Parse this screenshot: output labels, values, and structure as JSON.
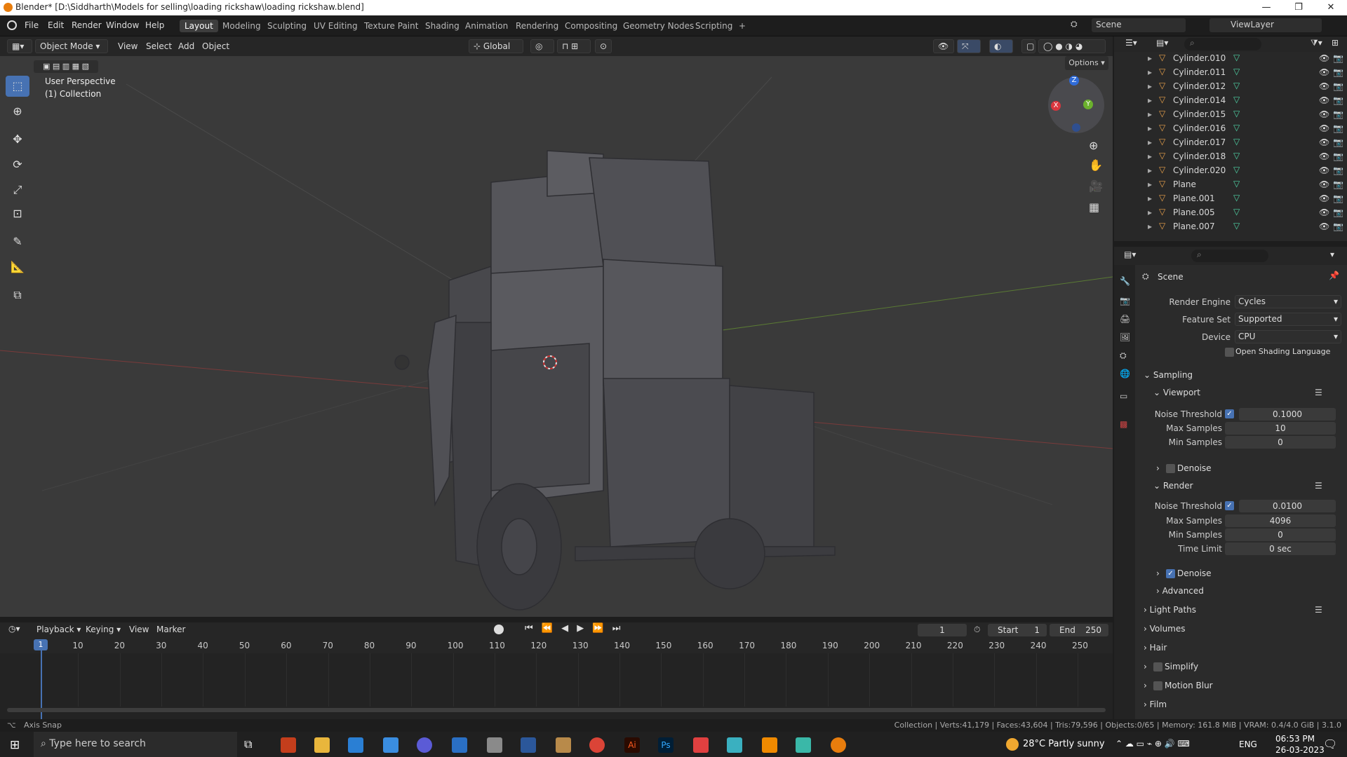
{
  "window": {
    "title": "Blender* [D:\\Siddharth\\Models for selling\\loading rickshaw\\loading rickshaw.blend]"
  },
  "menu": [
    "File",
    "Edit",
    "Render",
    "Window",
    "Help"
  ],
  "workspaces": [
    "Layout",
    "Modeling",
    "Sculpting",
    "UV Editing",
    "Texture Paint",
    "Shading",
    "Animation",
    "Rendering",
    "Compositing",
    "Geometry Nodes",
    "Scripting",
    "+"
  ],
  "active_workspace": "Layout",
  "scene_name": "Scene",
  "view_layer": "ViewLayer",
  "viewport_header": {
    "mode": "Object Mode",
    "items": [
      "View",
      "Select",
      "Add",
      "Object"
    ],
    "orientation": "Global",
    "options": "Options"
  },
  "viewport": {
    "perspective": "User Perspective",
    "collection": "(1) Collection",
    "gizmo_axes": [
      "X",
      "Y",
      "Z"
    ]
  },
  "outliner": {
    "items": [
      "Cylinder.010",
      "Cylinder.011",
      "Cylinder.012",
      "Cylinder.014",
      "Cylinder.015",
      "Cylinder.016",
      "Cylinder.017",
      "Cylinder.018",
      "Cylinder.020",
      "Plane",
      "Plane.001",
      "Plane.005",
      "Plane.007"
    ]
  },
  "properties": {
    "context": "Scene",
    "render_engine_label": "Render Engine",
    "render_engine": "Cycles",
    "feature_set_label": "Feature Set",
    "feature_set": "Supported",
    "device_label": "Device",
    "device": "CPU",
    "osl_label": "Open Shading Language",
    "sampling": "Sampling",
    "viewport": {
      "title": "Viewport",
      "noise_threshold_label": "Noise Threshold",
      "noise_threshold": "0.1000",
      "max_samples_label": "Max Samples",
      "max_samples": "10",
      "min_samples_label": "Min Samples",
      "min_samples": "0",
      "denoise_label": "Denoise"
    },
    "render": {
      "title": "Render",
      "noise_threshold_label": "Noise Threshold",
      "noise_threshold": "0.0100",
      "max_samples_label": "Max Samples",
      "max_samples": "4096",
      "min_samples_label": "Min Samples",
      "min_samples": "0",
      "time_limit_label": "Time Limit",
      "time_limit": "0 sec",
      "denoise_label": "Denoise",
      "advanced_label": "Advanced"
    },
    "sections": [
      "Light Paths",
      "Volumes",
      "Hair",
      "Simplify",
      "Motion Blur",
      "Film"
    ]
  },
  "timeline": {
    "menus": [
      "Playback",
      "Keying",
      "View",
      "Marker"
    ],
    "current_frame": "1",
    "start_label": "Start",
    "start": "1",
    "end_label": "End",
    "end": "250",
    "ticks": [
      "1",
      "10",
      "20",
      "30",
      "40",
      "50",
      "60",
      "70",
      "80",
      "90",
      "100",
      "110",
      "120",
      "130",
      "140",
      "150",
      "160",
      "170",
      "180",
      "190",
      "200",
      "210",
      "220",
      "230",
      "240",
      "250"
    ]
  },
  "statusbar": {
    "left": "Axis Snap",
    "right": "Collection | Verts:41,179 | Faces:43,604 | Tris:79,596 | Objects:0/65 | Memory: 161.8 MiB | VRAM: 0.4/4.0 GiB | 3.1.0"
  },
  "taskbar": {
    "search_placeholder": "Type here to search",
    "weather": "28°C  Partly sunny",
    "lang": "ENG",
    "time": "06:53 PM",
    "date": "26-03-2023"
  },
  "colors": {
    "accent": "#4772b3",
    "blender_orange": "#e87d0d",
    "viewport_bg": "#3a3a3a",
    "axis_x": "#d9363e",
    "axis_y": "#6bb12d",
    "axis_z": "#2f6bd8"
  }
}
